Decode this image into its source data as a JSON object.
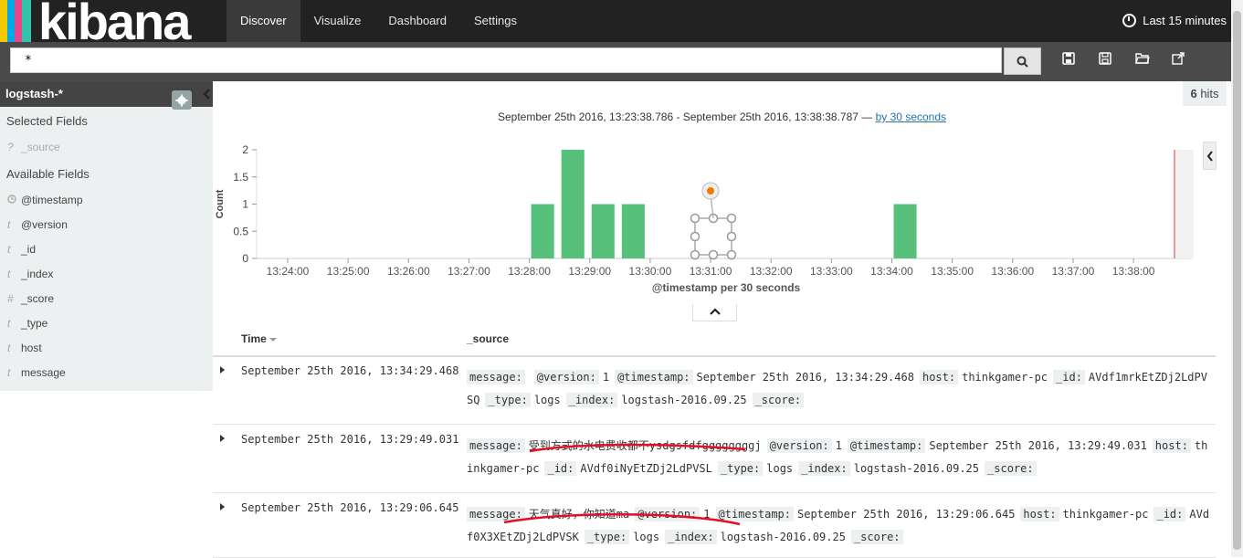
{
  "app": {
    "logo_text": "kibana",
    "brand_colors": [
      "#f3ca00",
      "#00a9e5",
      "#e8478b",
      "#32c3a8",
      "#ffffff"
    ]
  },
  "nav": {
    "items": [
      {
        "label": "Discover",
        "active": true
      },
      {
        "label": "Visualize",
        "active": false
      },
      {
        "label": "Dashboard",
        "active": false
      },
      {
        "label": "Settings",
        "active": false
      }
    ]
  },
  "timepicker": {
    "label": "Last 15 minutes",
    "icon": "clock-icon"
  },
  "search": {
    "value": "*",
    "button_icon": "search-icon"
  },
  "toolbar": {
    "icons": [
      "new-search-icon",
      "save-search-icon",
      "open-search-icon",
      "share-search-icon"
    ]
  },
  "sidebar": {
    "index_pattern": "logstash-*",
    "selected_fields_label": "Selected Fields",
    "selected_fields": [
      {
        "type": "?",
        "name": "_source"
      }
    ],
    "available_fields_label": "Available Fields",
    "available_fields": [
      {
        "type": "clock",
        "name": "@timestamp"
      },
      {
        "type": "t",
        "name": "@version"
      },
      {
        "type": "t",
        "name": "_id"
      },
      {
        "type": "t",
        "name": "_index"
      },
      {
        "type": "#",
        "name": "_score"
      },
      {
        "type": "t",
        "name": "_type"
      },
      {
        "type": "t",
        "name": "host"
      },
      {
        "type": "t",
        "name": "message"
      }
    ]
  },
  "hits": {
    "count": "6",
    "label": "hits"
  },
  "range": {
    "text": "September 25th 2016, 13:23:38.786 - September 25th 2016, 13:38:38.787 —",
    "interval_link": "by 30 seconds"
  },
  "chart_data": {
    "type": "bar",
    "ylabel": "Count",
    "xlabel": "@timestamp per 30 seconds",
    "ylim": [
      0,
      2
    ],
    "yticks": [
      "0",
      "0.5",
      "1",
      "1.5",
      "2"
    ],
    "xticks": [
      "13:24:00",
      "13:25:00",
      "13:26:00",
      "13:27:00",
      "13:28:00",
      "13:29:00",
      "13:30:00",
      "13:31:00",
      "13:32:00",
      "13:33:00",
      "13:34:00",
      "13:35:00",
      "13:36:00",
      "13:37:00",
      "13:38:00"
    ],
    "x": [
      "13:28:00",
      "13:28:30",
      "13:29:00",
      "13:29:30",
      "13:34:00"
    ],
    "values": [
      1,
      2,
      1,
      1,
      1
    ],
    "bar_color": "#57c17b"
  },
  "table": {
    "time_header": "Time",
    "source_header": "_source",
    "rows": [
      {
        "time": "September 25th 2016, 13:34:29.468",
        "fields": [
          {
            "k": "message:",
            "v": ""
          },
          {
            "k": "@version:",
            "v": "1"
          },
          {
            "k": "@timestamp:",
            "v": "September 25th 2016, 13:34:29.468"
          },
          {
            "k": "host:",
            "v": "thinkgamer-pc"
          },
          {
            "k": "_id:",
            "v": "AVdf1mrkEtZDj2LdPVSQ"
          },
          {
            "k": "_type:",
            "v": "logs"
          },
          {
            "k": "_index:",
            "v": "logstash-2016.09.25"
          },
          {
            "k": "_score:",
            "v": ""
          }
        ]
      },
      {
        "time": "September 25th 2016, 13:29:49.031",
        "fields": [
          {
            "k": "message:",
            "v": "受到方式的水电费收都不ysdgsfdfggggggggj"
          },
          {
            "k": "@version:",
            "v": "1"
          },
          {
            "k": "@timestamp:",
            "v": "September 25th 2016, 13:29:49.031"
          },
          {
            "k": "host:",
            "v": "thinkgamer-pc"
          },
          {
            "k": "_id:",
            "v": "AVdf0iNyEtZDj2LdPVSL"
          },
          {
            "k": "_type:",
            "v": "logs"
          },
          {
            "k": "_index:",
            "v": "logstash-2016.09.25"
          },
          {
            "k": "_score:",
            "v": ""
          }
        ]
      },
      {
        "time": "September 25th 2016, 13:29:06.645",
        "fields": [
          {
            "k": "message:",
            "v": "天气真好，你知道ma"
          },
          {
            "k": "@version:",
            "v": "1"
          },
          {
            "k": "@timestamp:",
            "v": "September 25th 2016, 13:29:06.645"
          },
          {
            "k": "host:",
            "v": "thinkgamer-pc"
          },
          {
            "k": "_id:",
            "v": "AVdf0X3XEtZDj2LdPVSK"
          },
          {
            "k": "_type:",
            "v": "logs"
          },
          {
            "k": "_index:",
            "v": "logstash-2016.09.25"
          },
          {
            "k": "_score:",
            "v": ""
          }
        ]
      }
    ]
  }
}
